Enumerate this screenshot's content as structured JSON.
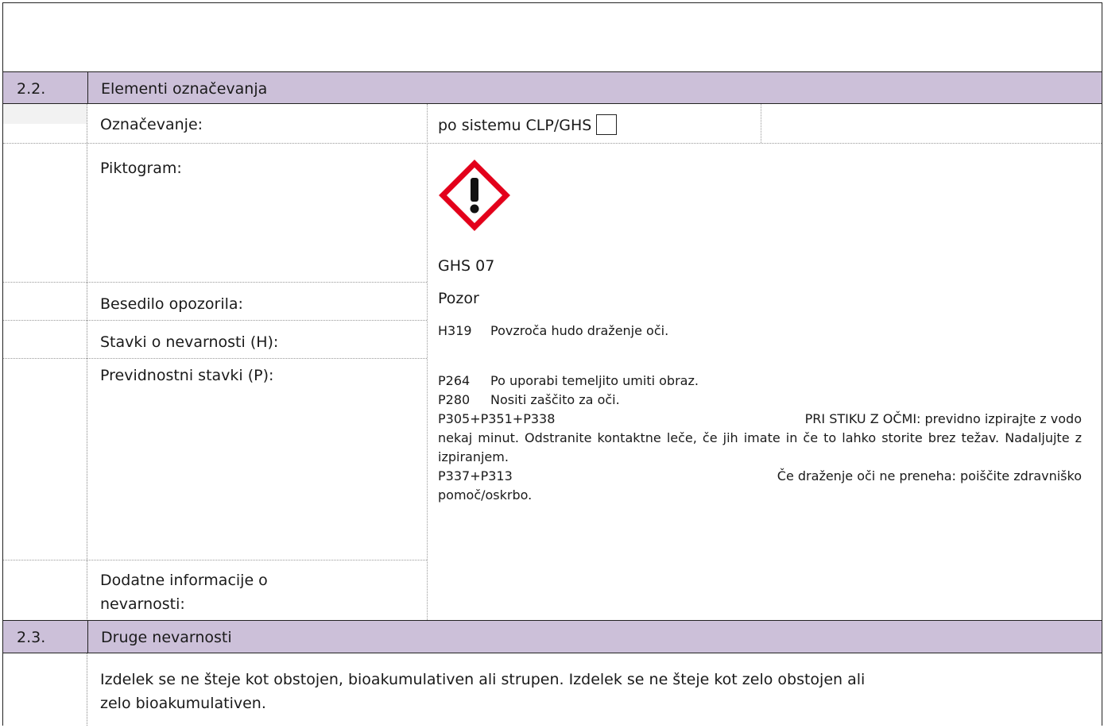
{
  "sections": [
    {
      "number": "2.2.",
      "title": "Elementi označevanja"
    },
    {
      "number": "2.3.",
      "title": "Druge nevarnosti"
    }
  ],
  "rows": {
    "oznacevanje": {
      "label": "Označevanje:",
      "value": "po sistemu CLP/GHS"
    },
    "piktogram": {
      "label": "Piktogram:",
      "caption": "GHS 07",
      "icon": "ghs07-exclamation-icon"
    },
    "opozorilo": {
      "label": "Besedilo opozorila:",
      "value": "Pozor"
    },
    "h_stavki": {
      "label": "Stavki o nevarnosti (H):",
      "items": [
        {
          "code": "H319",
          "text": "Povzroča hudo draženje oči."
        }
      ]
    },
    "p_stavki": {
      "label": "Previdnostni stavki (P):",
      "p264": {
        "code": "P264",
        "text": "Po uporabi temeljito umiti obraz."
      },
      "p280": {
        "code": "P280",
        "text": "Nositi zaščito za oči."
      },
      "p305": {
        "code": "P305+P351+P338",
        "first": "PRI STIKU Z OČMI: previdno izpirajte z vodo",
        "rest": "nekaj minut. Odstranite kontaktne leče, če jih imate in če to lahko storite brez težav. Nadaljujte z izpiranjem."
      },
      "p337": {
        "code": "P337+P313",
        "first": "Če draženje oči ne preneha: poiščite zdravniško",
        "rest": "pomoč/oskrbo."
      }
    },
    "dodatne": {
      "label_line1": "Dodatne informacije o",
      "label_line2": "nevarnosti:"
    }
  },
  "other_hazards": {
    "line1": "Izdelek se ne šteje kot obstojen, bioakumulativen ali strupen. Izdelek se ne šteje kot zelo obstojen ali",
    "line2": "zelo bioakumulativen."
  },
  "colors": {
    "header_bg": "#ccc0d9",
    "row_bg": "#f2f2f2",
    "pictogram_red": "#e3001b"
  }
}
